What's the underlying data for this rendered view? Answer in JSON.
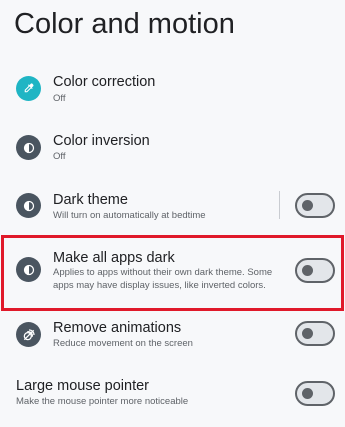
{
  "page": {
    "title": "Color and motion"
  },
  "settings": [
    {
      "title": "Color correction",
      "subtitle": "Off",
      "icon": "eyedropper-icon",
      "icon_bg": "#1fb5c4"
    },
    {
      "title": "Color inversion",
      "subtitle": "Off",
      "icon": "half-circle-icon",
      "icon_bg": "#4a5560"
    },
    {
      "title": "Dark theme",
      "subtitle": "Will turn on automatically at bedtime",
      "icon": "half-circle-icon",
      "icon_bg": "#4a5560",
      "toggle_on": false
    },
    {
      "title": "Make all apps dark",
      "subtitle_line1": "Applies to apps without their own dark theme. Some",
      "subtitle_line2": "apps may have display issues, like inverted colors.",
      "icon": "half-circle-icon",
      "icon_bg": "#4a5560",
      "toggle_on": false,
      "highlighted": true
    },
    {
      "title": "Remove animations",
      "subtitle": "Reduce movement on the screen",
      "icon": "animation-icon",
      "icon_bg": "#4a5560",
      "toggle_on": false
    },
    {
      "title": "Large mouse pointer",
      "subtitle": "Make the mouse pointer more noticeable",
      "toggle_on": false
    }
  ],
  "colors": {
    "highlight": "#e0192a",
    "accent_teal": "#1fb5c4",
    "icon_dark": "#4a5560"
  }
}
